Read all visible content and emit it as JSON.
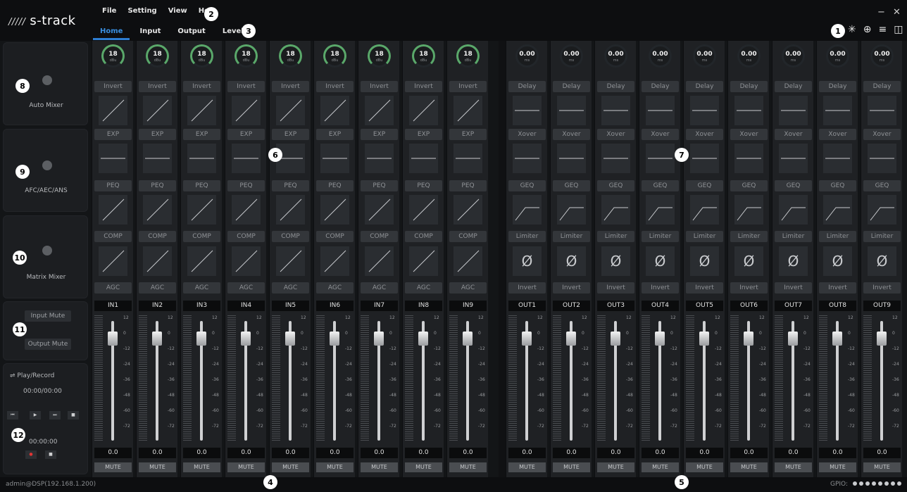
{
  "app": {
    "logo_text": "s-track",
    "logo_mark": "/////"
  },
  "menu": [
    "File",
    "Setting",
    "View",
    "Help"
  ],
  "tabs": [
    "Home",
    "Input",
    "Output",
    "Level"
  ],
  "badges": [
    "1",
    "2",
    "3",
    "4",
    "5",
    "6",
    "7",
    "8",
    "9",
    "10",
    "11",
    "12"
  ],
  "window": {
    "minimize": "−",
    "close": "✕"
  },
  "top_icons": [
    "✳",
    "⊕",
    "≡",
    "◫"
  ],
  "sidebar": {
    "auto_mixer": "Auto Mixer",
    "afc": "AFC/AEC/ANS",
    "matrix": "Matrix Mixer",
    "input_mute": "Input Mute",
    "output_mute": "Output Mute",
    "play_record": "Play/Record",
    "play_time": "00:00/00:00",
    "rec_time": "00:00:00",
    "usb_icon": "⇌"
  },
  "inputs": {
    "gain": "18",
    "gain_unit": "dBu",
    "stages": [
      "Invert",
      "EXP",
      "PEQ",
      "COMP",
      "AGC"
    ],
    "names": [
      "IN1",
      "IN2",
      "IN3",
      "IN4",
      "IN5",
      "IN6",
      "IN7",
      "IN8",
      "IN9"
    ]
  },
  "outputs": {
    "delay": "0.00",
    "delay_unit": "ms",
    "stages": [
      "Delay",
      "Xover",
      "GEQ",
      "Limiter",
      "Invert"
    ],
    "phase_symbol": "Ø",
    "names": [
      "OUT1",
      "OUT2",
      "OUT3",
      "OUT4",
      "OUT5",
      "OUT6",
      "OUT7",
      "OUT8",
      "OUT9"
    ]
  },
  "fader": {
    "ticks": [
      "12",
      "0",
      "-12",
      "-24",
      "-36",
      "-48",
      "-60",
      "-72"
    ],
    "value": "0.0",
    "mute": "MUTE",
    "level_fraction": 0.9
  },
  "status": {
    "user": "admin@DSP(192.168.1.200)",
    "gpio": "GPIO:",
    "gpio_count": 8
  }
}
